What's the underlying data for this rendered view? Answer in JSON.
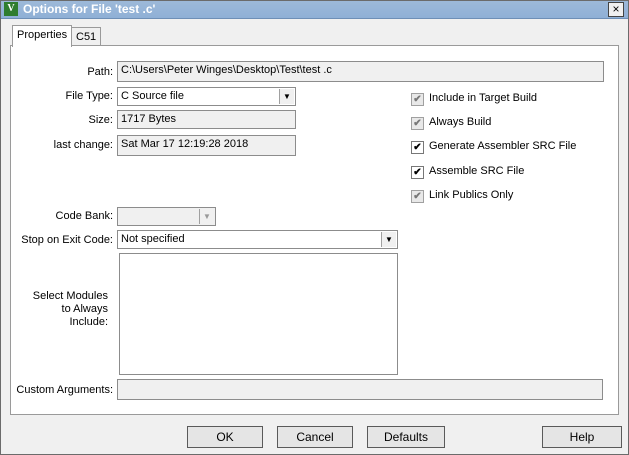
{
  "window": {
    "title": "Options for File 'test .c'",
    "close_glyph": "×"
  },
  "tabs": [
    {
      "label": "Properties"
    },
    {
      "label": "C51"
    }
  ],
  "fields": {
    "path_label": "Path:",
    "path_value": "C:\\Users\\Peter Winges\\Desktop\\Test\\test .c",
    "filetype_label": "File Type:",
    "filetype_value": "C Source file",
    "size_label": "Size:",
    "size_value": "1717 Bytes",
    "lastchange_label": "last change:",
    "lastchange_value": "Sat Mar 17 12:19:28 2018",
    "codebank_label": "Code Bank:",
    "codebank_value": "",
    "stopexit_label": "Stop on Exit Code:",
    "stopexit_value": "Not specified",
    "modules_label": "Select Modules to Always Include:",
    "custom_label": "Custom Arguments:",
    "custom_value": ""
  },
  "checkboxes": [
    {
      "label": "Include in Target Build",
      "checked": true,
      "disabled": true
    },
    {
      "label": "Always Build",
      "checked": true,
      "disabled": true
    },
    {
      "label": "Generate Assembler SRC File",
      "checked": true,
      "disabled": false
    },
    {
      "label": "Assemble SRC File",
      "checked": true,
      "disabled": false
    },
    {
      "label": "Link Publics Only",
      "checked": true,
      "disabled": true
    }
  ],
  "buttons": {
    "ok": "OK",
    "cancel": "Cancel",
    "defaults": "Defaults",
    "help": "Help"
  },
  "glyphs": {
    "check": "✔",
    "dropdown": "▼"
  }
}
